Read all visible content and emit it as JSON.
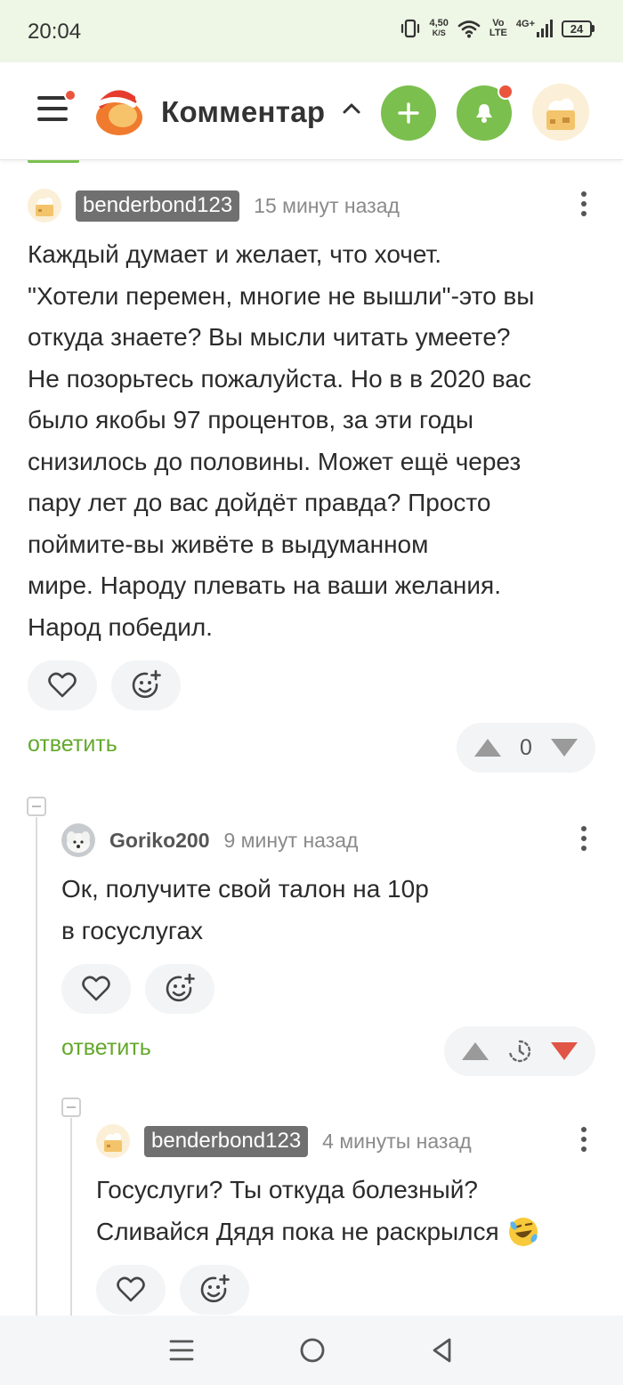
{
  "status_bar": {
    "time": "20:04",
    "network_speed_value": "4,50",
    "network_speed_unit": "K/S",
    "volte_top": "Vo",
    "volte_bottom": "LTE",
    "signal_label": "4G+",
    "battery": "24",
    "icons": [
      "vibrate-icon",
      "wifi-icon",
      "signal-bars-icon",
      "battery-icon"
    ]
  },
  "header": {
    "title": "Комментар",
    "menu_has_notification": true,
    "icons": [
      "menu-icon",
      "logo-icon",
      "chevron-up-icon",
      "plus-icon",
      "bell-icon",
      "user-avatar"
    ],
    "accent_color": "#7bbf4e",
    "notification_color": "#e9553d"
  },
  "comments": [
    {
      "author": "benderbond123",
      "time": "15 минут назад",
      "text_lines": [
        "Каждый думает и желает, что хочет.",
        "\"Хотели перемен, многие не вышли\"-это вы",
        "откуда знаете? Вы мысли читать умеете?",
        "Не позорьтесь пожалуйста. Но в в 2020 вас",
        "было якобы 97 процентов, за эти годы",
        "снизилось до половины. Может ещё через",
        "пару лет до вас дойдёт правда? Просто",
        "поймите-вы живёте в выдуманном",
        "мире. Народу плевать на ваши желания.",
        "Народ победил."
      ],
      "reply_label": "ответить",
      "rating": "0"
    },
    {
      "author": "Goriko200",
      "time": "9 минут назад",
      "text_lines": [
        "Ок, получите свой талон на 10р",
        "в госуслугах"
      ],
      "reply_label": "ответить",
      "rating_state": "pending",
      "downvote_color": "#e05545"
    },
    {
      "author": "benderbond123",
      "time": "4 минуты назад",
      "text_lines": [
        "Госуслуги? Ты откуда болезный?",
        "Сливайся Дядя пока не раскрылся"
      ],
      "emoji": "rolling-on-floor-laughing-emoji"
    }
  ],
  "nav_bar": {
    "icons": [
      "recent-apps-icon",
      "home-icon",
      "back-icon"
    ]
  }
}
